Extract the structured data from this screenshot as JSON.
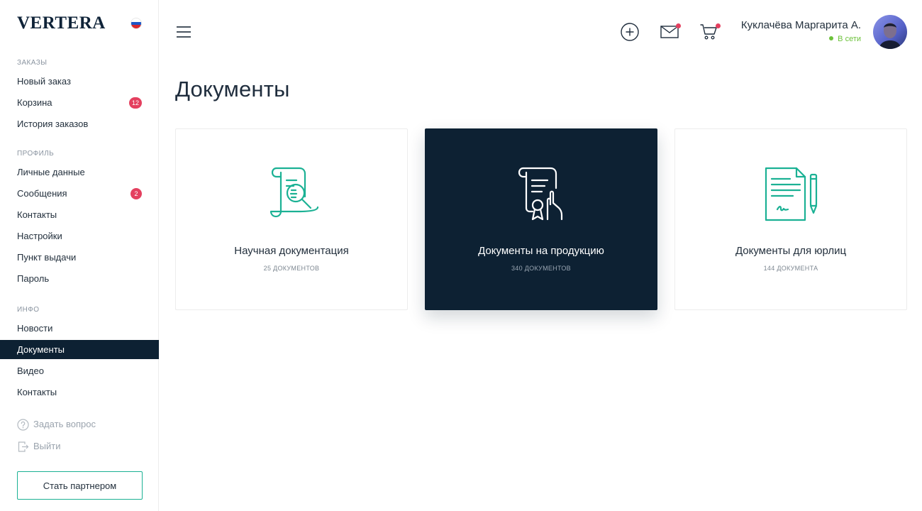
{
  "brand": {
    "logo": "VERTERA",
    "flag_colors": [
      "#ffffff",
      "#1c57c7",
      "#d8282c"
    ]
  },
  "sidebar": {
    "orders_title": "ЗАКАЗЫ",
    "orders": [
      {
        "label": "Новый заказ"
      },
      {
        "label": "Корзина",
        "badge": "12"
      },
      {
        "label": "История заказов"
      }
    ],
    "profile_title": "ПРОФИЛЬ",
    "profile": [
      {
        "label": "Личные данные"
      },
      {
        "label": "Сообщения",
        "badge": "2"
      },
      {
        "label": "Контакты"
      },
      {
        "label": "Настройки"
      },
      {
        "label": "Пункт выдачи"
      },
      {
        "label": "Пароль"
      }
    ],
    "info_title": "ИНФО",
    "info": [
      {
        "label": "Новости"
      },
      {
        "label": "Документы",
        "active": true
      },
      {
        "label": "Видео"
      },
      {
        "label": "Контакты"
      }
    ],
    "ask_label": "Задать вопрос",
    "logout_label": "Выйти",
    "partner_button": "Стать партнером"
  },
  "header": {
    "icons": [
      "menu-icon",
      "plus-circle-icon",
      "mail-icon",
      "cart-icon"
    ],
    "user_name": "Куклачёва Маргарита А.",
    "user_status": "В сети"
  },
  "main": {
    "title": "Документы",
    "cards": [
      {
        "title": "Научная документация",
        "count": "25 ДОКУМЕНТОВ",
        "icon": "scroll-search-icon"
      },
      {
        "title": "Документы на продукцию",
        "count": "340 ДОКУМЕНТОВ",
        "icon": "certificate-hand-icon"
      },
      {
        "title": "Документы для юрлиц",
        "count": "144 ДОКУМЕНТА",
        "icon": "document-pen-icon"
      }
    ]
  },
  "colors": {
    "accent": "#1bb194",
    "dark": "#0d2133",
    "badge": "#e4405f",
    "online": "#6cc23a"
  }
}
